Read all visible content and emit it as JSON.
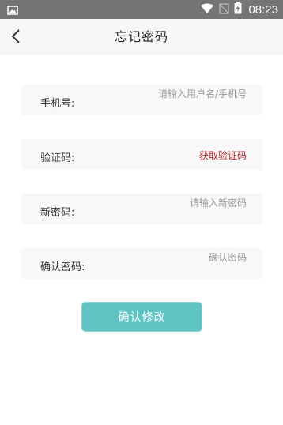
{
  "status_bar": {
    "time": "08:23",
    "icons": [
      "image-icon",
      "wifi-icon",
      "no-signal-icon",
      "battery-charging-icon"
    ]
  },
  "header": {
    "title": "忘记密码",
    "back_icon": "chevron-left-icon"
  },
  "form": {
    "phone": {
      "label": "手机号:",
      "placeholder": "请输入用户名/手机号",
      "value": ""
    },
    "code": {
      "label": "验证码:",
      "action_label": "获取验证码",
      "value": ""
    },
    "new_password": {
      "label": "新密码:",
      "placeholder": "请输入新密码",
      "value": ""
    },
    "confirm_password": {
      "label": "确认密码:",
      "placeholder": "确认密码",
      "value": ""
    }
  },
  "submit": {
    "label": "确认修改"
  },
  "colors": {
    "status_bar": "#757575",
    "header_bg": "#f7f7f7",
    "row_bg": "#f8f8f8",
    "action_link": "#b22222",
    "button": "#5fc3c3"
  }
}
